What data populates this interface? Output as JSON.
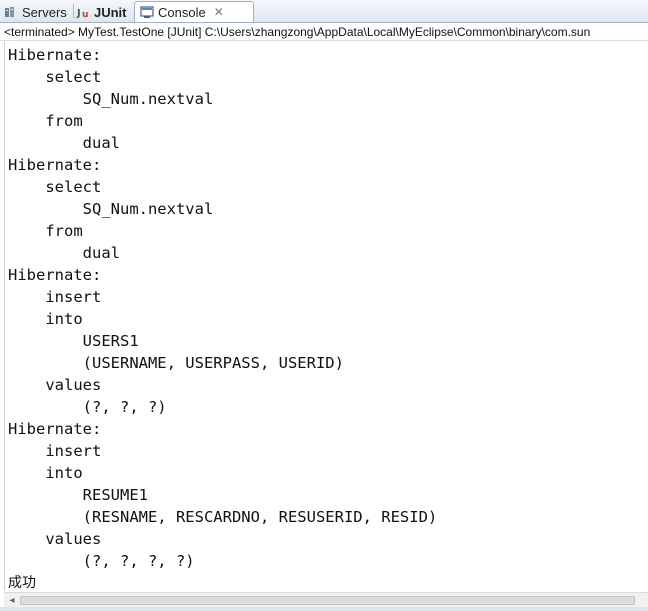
{
  "tabs": {
    "servers": {
      "label": "Servers",
      "icon": "servers-icon"
    },
    "junit": {
      "label": "JUnit",
      "icon": "junit-icon"
    },
    "console": {
      "label": "Console",
      "icon": "console-icon",
      "close": "✕"
    }
  },
  "status": "<terminated> MyTest.TestOne [JUnit] C:\\Users\\zhangzong\\AppData\\Local\\MyEclipse\\Common\\binary\\com.sun",
  "console_lines": [
    "Hibernate:",
    "    select",
    "        SQ_Num.nextval",
    "    from",
    "        dual",
    "Hibernate:",
    "    select",
    "        SQ_Num.nextval",
    "    from",
    "        dual",
    "Hibernate:",
    "    insert",
    "    into",
    "        USERS1",
    "        (USERNAME, USERPASS, USERID)",
    "    values",
    "        (?, ?, ?)",
    "Hibernate:",
    "    insert",
    "    into",
    "        RESUME1",
    "        (RESNAME, RESCARDNO, RESUSERID, RESID)",
    "    values",
    "        (?, ?, ?, ?)",
    "成功"
  ],
  "scroll": {
    "left_arrow": "◂"
  }
}
